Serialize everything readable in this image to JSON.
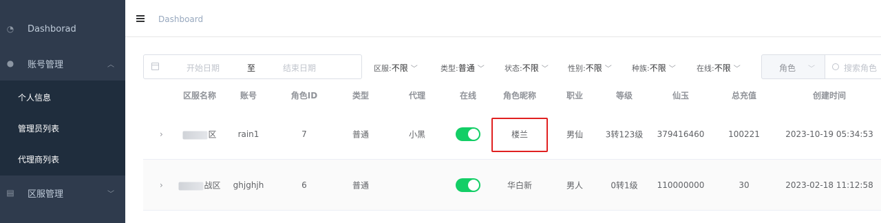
{
  "sidebar": {
    "items": [
      {
        "label": "Dashborad",
        "icon": "dashboard-icon"
      },
      {
        "label": "账号管理",
        "icon": "users-icon"
      },
      {
        "label": "区服管理",
        "icon": "server-icon"
      }
    ],
    "sub_items": [
      "个人信息",
      "管理员列表",
      "代理商列表"
    ]
  },
  "header": {
    "breadcrumb": "Dashboard"
  },
  "filters": {
    "start_placeholder": "开始日期",
    "range_sep": "至",
    "end_placeholder": "结束日期",
    "selects": [
      {
        "label": "区服:",
        "value": "不限"
      },
      {
        "label": "类型:",
        "value": "普通"
      },
      {
        "label": "状态:",
        "value": "不限"
      },
      {
        "label": "性别:",
        "value": "不限"
      },
      {
        "label": "种族:",
        "value": "不限"
      },
      {
        "label": "在线:",
        "value": "不限"
      }
    ],
    "role_select": "角色",
    "search_placeholder": "搜索角色"
  },
  "table": {
    "columns": [
      "区服名称",
      "账号",
      "角色ID",
      "类型",
      "代理",
      "在线",
      "角色昵称",
      "职业",
      "等级",
      "仙玉",
      "总充值",
      "创建时间"
    ],
    "rows": [
      {
        "server": "区",
        "account": "rain1",
        "role_id": "7",
        "type": "普通",
        "agent": "小黑",
        "online": true,
        "nickname": "楼兰",
        "profession": "男仙",
        "level": "3转123级",
        "jade": "379416460",
        "recharge": "100221",
        "created": "2023-10-19 05:34:53"
      },
      {
        "server": "战区",
        "account": "ghjghjh",
        "role_id": "6",
        "type": "普通",
        "agent": "",
        "online": true,
        "nickname": "华白新",
        "profession": "男人",
        "level": "0转1级",
        "jade": "110000000",
        "recharge": "30",
        "created": "2023-02-18 11:12:58"
      }
    ]
  },
  "colors": {
    "sidebar_bg": "#2f3b4d",
    "submenu_bg": "#1f2d3d",
    "switch_on": "#13ce66",
    "highlight": "#e02020"
  }
}
